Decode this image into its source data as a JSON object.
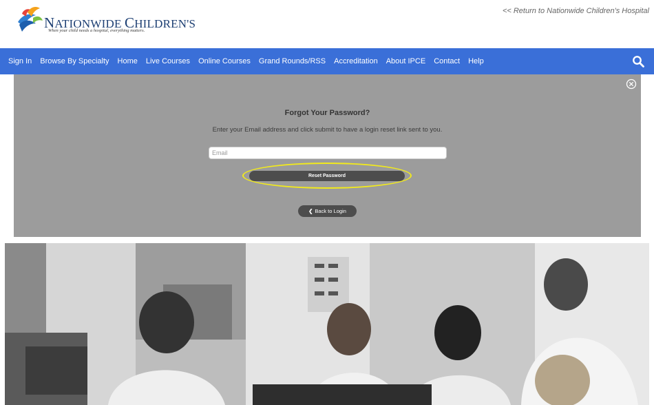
{
  "header": {
    "logo_name_first": "N",
    "logo_name_rest": "ATIONWIDE ",
    "logo_name_c": "C",
    "logo_name_end": "HILDREN'S",
    "logo_tagline": "When your child needs a hospital, everything matters.",
    "return_link": "<< Return to Nationwide Children's Hospital"
  },
  "nav": {
    "items": [
      {
        "label": "Sign In"
      },
      {
        "label": "Browse By Specialty"
      },
      {
        "label": "Home"
      },
      {
        "label": "Live Courses"
      },
      {
        "label": "Online Courses"
      },
      {
        "label": "Grand Rounds/RSS"
      },
      {
        "label": "Accreditation"
      },
      {
        "label": "About IPCE"
      },
      {
        "label": "Contact"
      },
      {
        "label": "Help"
      }
    ],
    "search_icon": "search-icon"
  },
  "form": {
    "title": "Forgot Your Password?",
    "instructions": "Enter your Email address and click submit to have a login reset link sent to you.",
    "email_placeholder": "Email",
    "email_value": "",
    "reset_label": "Reset Password",
    "back_label": "Back to Login",
    "close_icon": "close-icon"
  },
  "colors": {
    "nav_bg": "#3a6fd8",
    "panel_bg": "#9c9c9c",
    "button_bg": "#4d4d4d",
    "highlight": "#f2ea1c"
  }
}
